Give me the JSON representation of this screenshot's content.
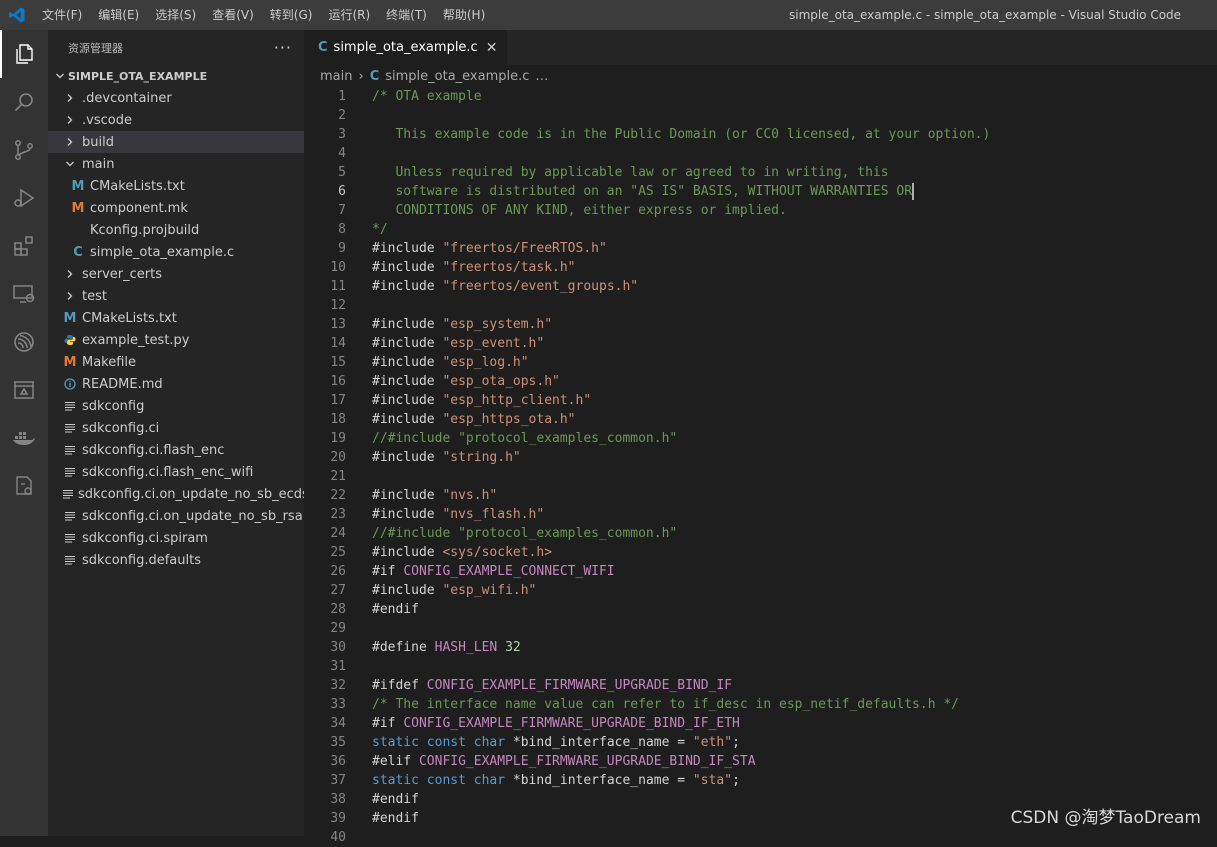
{
  "titlebar": {
    "menu": [
      "文件(F)",
      "编辑(E)",
      "选择(S)",
      "查看(V)",
      "转到(G)",
      "运行(R)",
      "终端(T)",
      "帮助(H)"
    ],
    "window_title": "simple_ota_example.c - simple_ota_example - Visual Studio Code"
  },
  "activitybar": {
    "icons": [
      "files-icon",
      "search-icon",
      "source-control-icon",
      "run-debug-icon",
      "extensions-icon",
      "remote-explorer-icon",
      "espressif-icon",
      "panel-icon",
      "docker-icon",
      "cmake-icon"
    ]
  },
  "sidebar": {
    "title": "资源管理器",
    "more": "···",
    "section": "SIMPLE_OTA_EXAMPLE",
    "tree": [
      {
        "label": ".devcontainer",
        "kind": "folder",
        "depth": 1,
        "open": false
      },
      {
        "label": ".vscode",
        "kind": "folder",
        "depth": 1,
        "open": false
      },
      {
        "label": "build",
        "kind": "folder",
        "depth": 1,
        "open": false,
        "selected": true
      },
      {
        "label": "main",
        "kind": "folder",
        "depth": 1,
        "open": true
      },
      {
        "label": "CMakeLists.txt",
        "kind": "cmake",
        "depth": 2
      },
      {
        "label": "component.mk",
        "kind": "make",
        "depth": 2
      },
      {
        "label": "Kconfig.projbuild",
        "kind": "plain",
        "depth": 2
      },
      {
        "label": "simple_ota_example.c",
        "kind": "c",
        "depth": 2
      },
      {
        "label": "server_certs",
        "kind": "folder",
        "depth": 1,
        "open": false
      },
      {
        "label": "test",
        "kind": "folder",
        "depth": 1,
        "open": false
      },
      {
        "label": "CMakeLists.txt",
        "kind": "cmake",
        "depth": 1
      },
      {
        "label": "example_test.py",
        "kind": "python",
        "depth": 1
      },
      {
        "label": "Makefile",
        "kind": "make",
        "depth": 1
      },
      {
        "label": "README.md",
        "kind": "info",
        "depth": 1
      },
      {
        "label": "sdkconfig",
        "kind": "lines",
        "depth": 1
      },
      {
        "label": "sdkconfig.ci",
        "kind": "lines",
        "depth": 1
      },
      {
        "label": "sdkconfig.ci.flash_enc",
        "kind": "lines",
        "depth": 1
      },
      {
        "label": "sdkconfig.ci.flash_enc_wifi",
        "kind": "lines",
        "depth": 1
      },
      {
        "label": "sdkconfig.ci.on_update_no_sb_ecdsa",
        "kind": "lines",
        "depth": 1
      },
      {
        "label": "sdkconfig.ci.on_update_no_sb_rsa",
        "kind": "lines",
        "depth": 1
      },
      {
        "label": "sdkconfig.ci.spiram",
        "kind": "lines",
        "depth": 1
      },
      {
        "label": "sdkconfig.defaults",
        "kind": "lines",
        "depth": 1
      }
    ]
  },
  "editor": {
    "tab": {
      "icon": "C",
      "label": "simple_ota_example.c",
      "close": "✕"
    },
    "breadcrumb": {
      "folder": "main",
      "sep": "›",
      "icon": "C",
      "file": "simple_ota_example.c",
      "tail": "…"
    },
    "current_line": 6,
    "lines": [
      [
        [
          "com",
          "/* OTA example"
        ]
      ],
      [
        [
          "com",
          ""
        ]
      ],
      [
        [
          "com",
          "   This example code is in the Public Domain (or CC0 licensed, at your option.)"
        ]
      ],
      [
        [
          "com",
          ""
        ]
      ],
      [
        [
          "com",
          "   Unless required by applicable law or agreed to in writing, this"
        ]
      ],
      [
        [
          "com",
          "   software is distributed on an \"AS IS\" BASIS, WITHOUT WARRANTIES OR"
        ]
      ],
      [
        [
          "com",
          "   CONDITIONS OF ANY KIND, either express or implied."
        ]
      ],
      [
        [
          "com",
          "*/"
        ]
      ],
      [
        [
          "txt",
          "#include "
        ],
        [
          "str",
          "\"freertos/FreeRTOS.h\""
        ]
      ],
      [
        [
          "txt",
          "#include "
        ],
        [
          "str",
          "\"freertos/task.h\""
        ]
      ],
      [
        [
          "txt",
          "#include "
        ],
        [
          "str",
          "\"freertos/event_groups.h\""
        ]
      ],
      [
        [
          "txt",
          ""
        ]
      ],
      [
        [
          "txt",
          "#include "
        ],
        [
          "str",
          "\"esp_system.h\""
        ]
      ],
      [
        [
          "txt",
          "#include "
        ],
        [
          "str",
          "\"esp_event.h\""
        ]
      ],
      [
        [
          "txt",
          "#include "
        ],
        [
          "str",
          "\"esp_log.h\""
        ]
      ],
      [
        [
          "txt",
          "#include "
        ],
        [
          "str",
          "\"esp_ota_ops.h\""
        ]
      ],
      [
        [
          "txt",
          "#include "
        ],
        [
          "str",
          "\"esp_http_client.h\""
        ]
      ],
      [
        [
          "txt",
          "#include "
        ],
        [
          "str",
          "\"esp_https_ota.h\""
        ]
      ],
      [
        [
          "com",
          "//#include \"protocol_examples_common.h\""
        ]
      ],
      [
        [
          "txt",
          "#include "
        ],
        [
          "str",
          "\"string.h\""
        ]
      ],
      [
        [
          "txt",
          ""
        ]
      ],
      [
        [
          "txt",
          "#include "
        ],
        [
          "str",
          "\"nvs.h\""
        ]
      ],
      [
        [
          "txt",
          "#include "
        ],
        [
          "str",
          "\"nvs_flash.h\""
        ]
      ],
      [
        [
          "com",
          "//#include \"protocol_examples_common.h\""
        ]
      ],
      [
        [
          "txt",
          "#include "
        ],
        [
          "str",
          "<sys/socket.h>"
        ]
      ],
      [
        [
          "txt",
          "#if "
        ],
        [
          "mac",
          "CONFIG_EXAMPLE_CONNECT_WIFI"
        ]
      ],
      [
        [
          "txt",
          "#include "
        ],
        [
          "str",
          "\"esp_wifi.h\""
        ]
      ],
      [
        [
          "txt",
          "#endif"
        ]
      ],
      [
        [
          "txt",
          ""
        ]
      ],
      [
        [
          "txt",
          "#define "
        ],
        [
          "mac",
          "HASH_LEN"
        ],
        [
          "txt",
          " "
        ],
        [
          "num",
          "32"
        ]
      ],
      [
        [
          "txt",
          ""
        ]
      ],
      [
        [
          "txt",
          "#ifdef "
        ],
        [
          "mac",
          "CONFIG_EXAMPLE_FIRMWARE_UPGRADE_BIND_IF"
        ]
      ],
      [
        [
          "com",
          "/* The interface name value can refer to if_desc in esp_netif_defaults.h */"
        ]
      ],
      [
        [
          "txt",
          "#if "
        ],
        [
          "mac",
          "CONFIG_EXAMPLE_FIRMWARE_UPGRADE_BIND_IF_ETH"
        ]
      ],
      [
        [
          "kw",
          "static"
        ],
        [
          "txt",
          " "
        ],
        [
          "kw",
          "const"
        ],
        [
          "txt",
          " "
        ],
        [
          "kw",
          "char"
        ],
        [
          "txt",
          " *bind_interface_name = "
        ],
        [
          "str",
          "\"eth\""
        ],
        [
          "txt",
          ";"
        ]
      ],
      [
        [
          "txt",
          "#elif "
        ],
        [
          "mac",
          "CONFIG_EXAMPLE_FIRMWARE_UPGRADE_BIND_IF_STA"
        ]
      ],
      [
        [
          "kw",
          "static"
        ],
        [
          "txt",
          " "
        ],
        [
          "kw",
          "const"
        ],
        [
          "txt",
          " "
        ],
        [
          "kw",
          "char"
        ],
        [
          "txt",
          " *bind_interface_name = "
        ],
        [
          "str",
          "\"sta\""
        ],
        [
          "txt",
          ";"
        ]
      ],
      [
        [
          "txt",
          "#endif"
        ]
      ],
      [
        [
          "txt",
          "#endif"
        ]
      ],
      [
        [
          "txt",
          ""
        ]
      ]
    ]
  },
  "watermark": "CSDN @淘梦TaoDream",
  "colors": {
    "comment": "#6a9955",
    "keyword": "#569cd6",
    "string": "#ce9178",
    "macro": "#c586c0",
    "number": "#b5cea8",
    "c_icon": "#519aba",
    "make_icon": "#e37933"
  }
}
